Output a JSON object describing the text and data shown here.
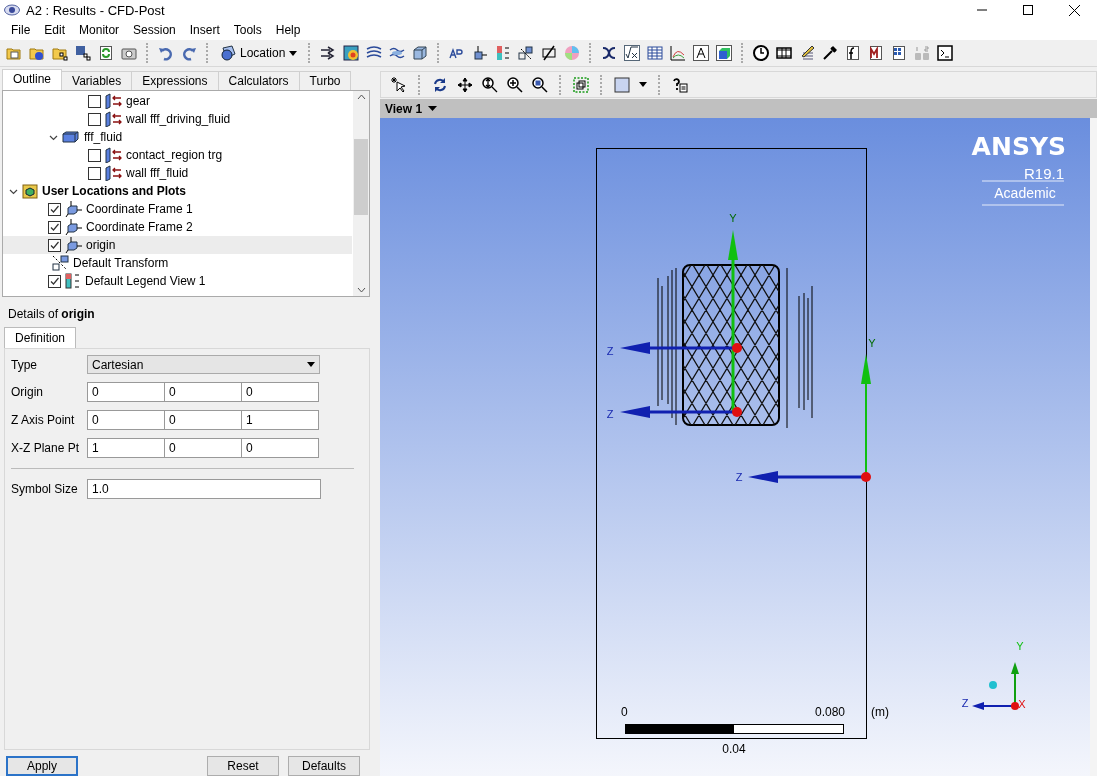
{
  "window": {
    "title": "A2 : Results - CFD-Post"
  },
  "menu": [
    "File",
    "Edit",
    "Monitor",
    "Session",
    "Insert",
    "Tools",
    "Help"
  ],
  "toolbar": {
    "location_button": "Location"
  },
  "outline": {
    "tabs": [
      {
        "label": "Outline",
        "selected": true
      },
      {
        "label": "Variables",
        "selected": false
      },
      {
        "label": "Expressions",
        "selected": false
      },
      {
        "label": "Calculators",
        "selected": false
      },
      {
        "label": "Turbo",
        "selected": false
      }
    ],
    "tree": [
      {
        "children": [
          {
            "children": [
              {
                "label": "gear",
                "checked": false,
                "selected": false
              },
              {
                "label": "wall fff_driving_fluid",
                "checked": false,
                "selected": false
              }
            ]
          },
          {
            "label": "fff_fluid",
            "expanded": true,
            "selected": false,
            "children": [
              {
                "label": "contact_region trg",
                "checked": false,
                "selected": false
              },
              {
                "label": "wall fff_fluid",
                "checked": false,
                "selected": false
              }
            ]
          }
        ]
      },
      {
        "label": "User Locations and Plots",
        "expanded": true,
        "selected": false,
        "children": [
          {
            "label": "Coordinate Frame 1",
            "checked": true,
            "selected": false
          },
          {
            "label": "Coordinate Frame 2",
            "checked": true,
            "selected": false
          },
          {
            "label": "origin",
            "checked": true,
            "selected": true
          },
          {
            "label": "Default Transform",
            "selected": false
          },
          {
            "label": "Default Legend View 1",
            "checked": true,
            "selected": false
          }
        ]
      }
    ]
  },
  "details": {
    "heading": "Details of **origin**",
    "tabs": [
      {
        "label": "Definition",
        "selected": true
      }
    ],
    "type": {
      "label": "Type",
      "value": "Cartesian"
    },
    "vectors": [
      {
        "label": "Origin",
        "values": [
          "0",
          "0",
          "0"
        ]
      },
      {
        "label": "Z Axis Point",
        "values": [
          "0",
          "0",
          "1"
        ]
      },
      {
        "label": "X-Z Plane Pt",
        "values": [
          "1",
          "0",
          "0"
        ]
      }
    ],
    "symbol_size": {
      "label": "Symbol Size",
      "value": "1.0"
    },
    "buttons": [
      "Apply",
      "Reset",
      "Defaults"
    ]
  },
  "viewer": {
    "view_selector": "View 1",
    "logo": {
      "name": "ANSYS",
      "version": "R19.1",
      "edition": "Academic"
    },
    "frames": [
      {
        "axis_labels": [
          "Y",
          "Z"
        ]
      },
      {
        "axis_labels": [
          "Z"
        ]
      },
      {
        "axis_labels": [
          "Y",
          "Z"
        ]
      }
    ],
    "scale": {
      "start": "0",
      "end": "0.080",
      "unit": "(m)",
      "mid": "0.04"
    },
    "triad": [
      "Y",
      "Z",
      "X"
    ]
  }
}
